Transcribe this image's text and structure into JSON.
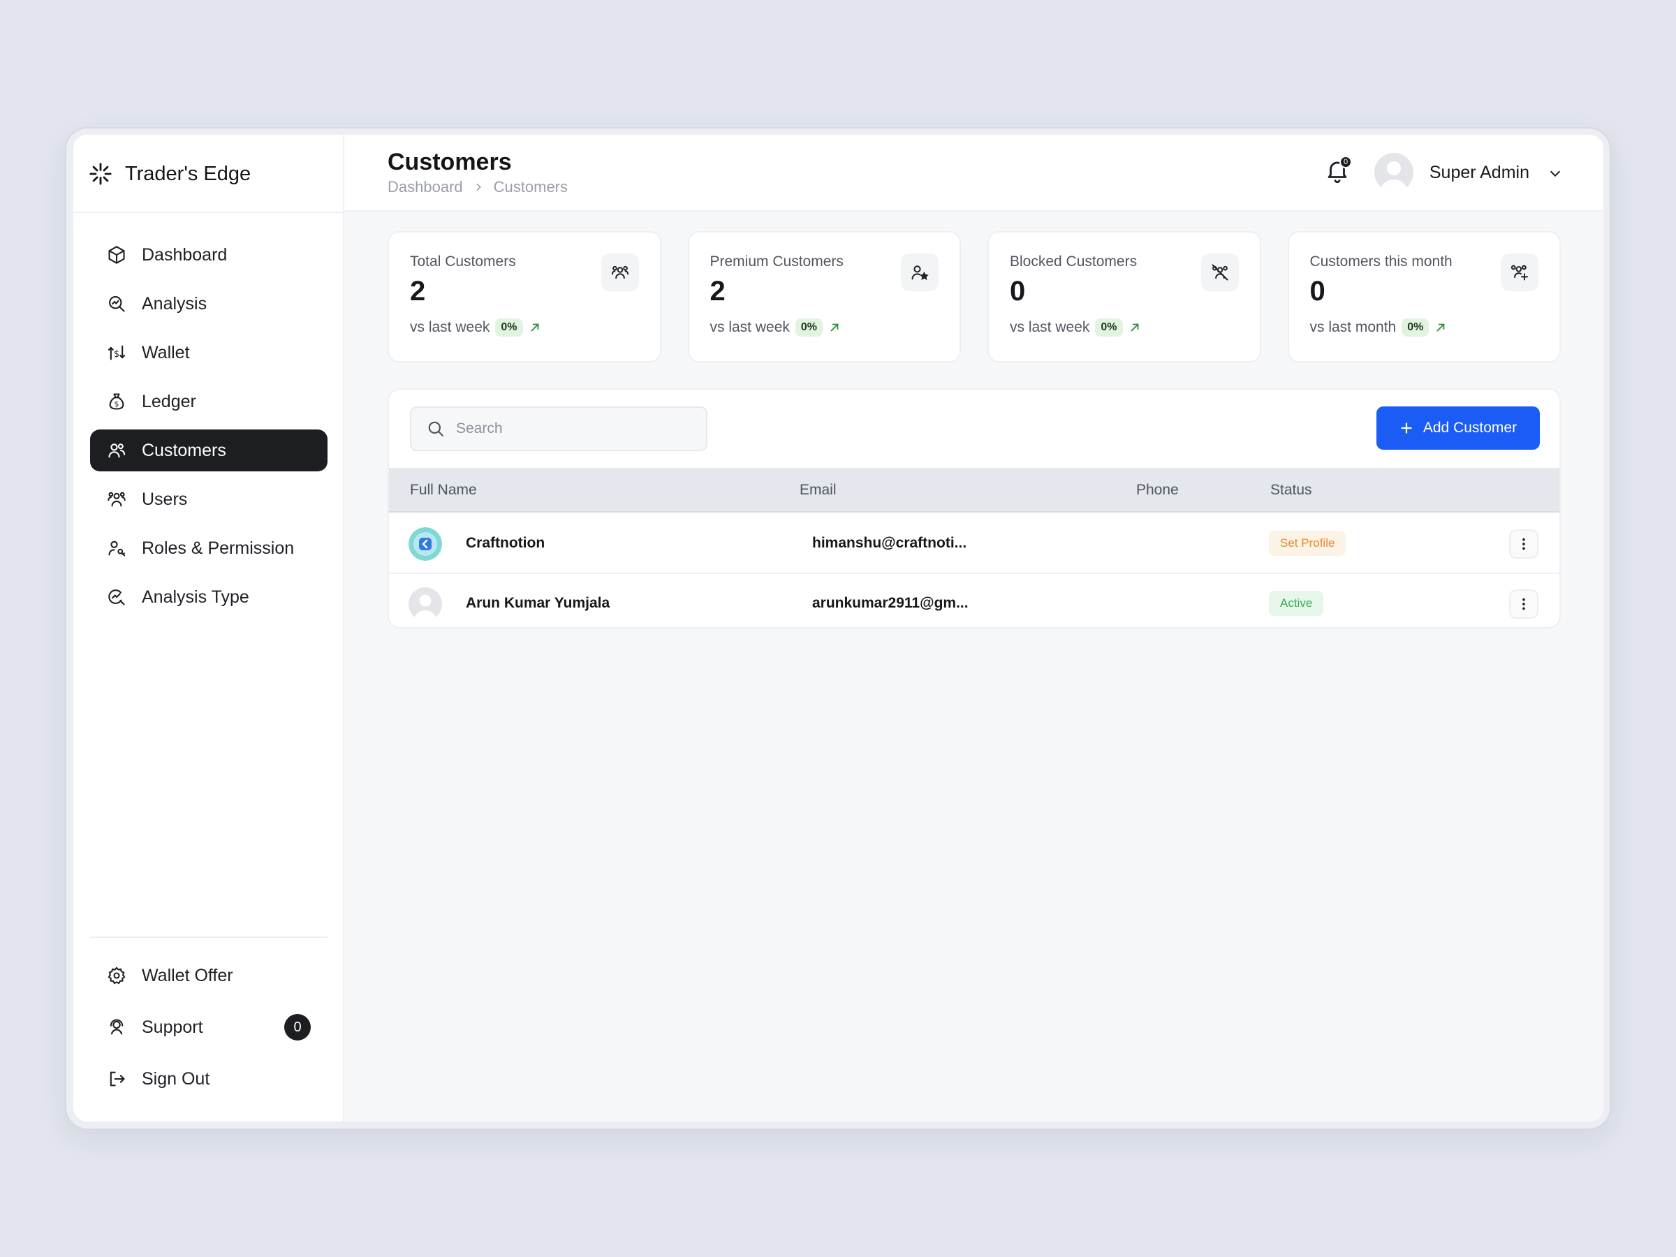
{
  "brand": {
    "name": "Trader's Edge"
  },
  "sidebar": {
    "items": [
      {
        "label": "Dashboard",
        "icon": "cube-icon"
      },
      {
        "label": "Analysis",
        "icon": "magnify-chart-icon"
      },
      {
        "label": "Wallet",
        "icon": "wallet-transfer-icon"
      },
      {
        "label": "Ledger",
        "icon": "money-bag-icon"
      },
      {
        "label": "Customers",
        "icon": "users-icon",
        "active": true
      },
      {
        "label": "Users",
        "icon": "group-icon"
      },
      {
        "label": "Roles & Permission",
        "icon": "user-key-icon"
      },
      {
        "label": "Analysis Type",
        "icon": "search-chart-icon"
      }
    ],
    "bottom": [
      {
        "label": "Wallet Offer",
        "icon": "gear-icon"
      },
      {
        "label": "Support",
        "icon": "support-icon",
        "count": "0"
      },
      {
        "label": "Sign Out",
        "icon": "sign-out-icon"
      }
    ]
  },
  "header": {
    "title": "Customers",
    "breadcrumb": [
      "Dashboard",
      "Customers"
    ],
    "notification_count": "0",
    "user_name": "Super Admin"
  },
  "stats": [
    {
      "label": "Total Customers",
      "value": "2",
      "foot": "vs last week",
      "pct": "0%",
      "icon": "group-icon"
    },
    {
      "label": "Premium Customers",
      "value": "2",
      "foot": "vs last week",
      "pct": "0%",
      "icon": "user-star-icon"
    },
    {
      "label": "Blocked Customers",
      "value": "0",
      "foot": "vs last week",
      "pct": "0%",
      "icon": "users-blocked-icon"
    },
    {
      "label": "Customers this month",
      "value": "0",
      "foot": "vs last month",
      "pct": "0%",
      "icon": "users-add-icon"
    }
  ],
  "table": {
    "search_placeholder": "Search",
    "add_label": "Add Customer",
    "columns": [
      "Full Name",
      "Email",
      "Phone",
      "Status"
    ],
    "rows": [
      {
        "name": "Craftnotion",
        "email": "himanshu@craftnoti...",
        "phone": "",
        "status": "Set Profile"
      },
      {
        "name": "Arun Kumar Yumjala",
        "email": "arunkumar2911@gm...",
        "phone": "",
        "status": "Active"
      }
    ]
  },
  "colors": {
    "accent": "#1a5cf5",
    "active_nav": "#1d1e22",
    "status_set_profile": "#e8892a",
    "status_active": "#3bab55"
  }
}
